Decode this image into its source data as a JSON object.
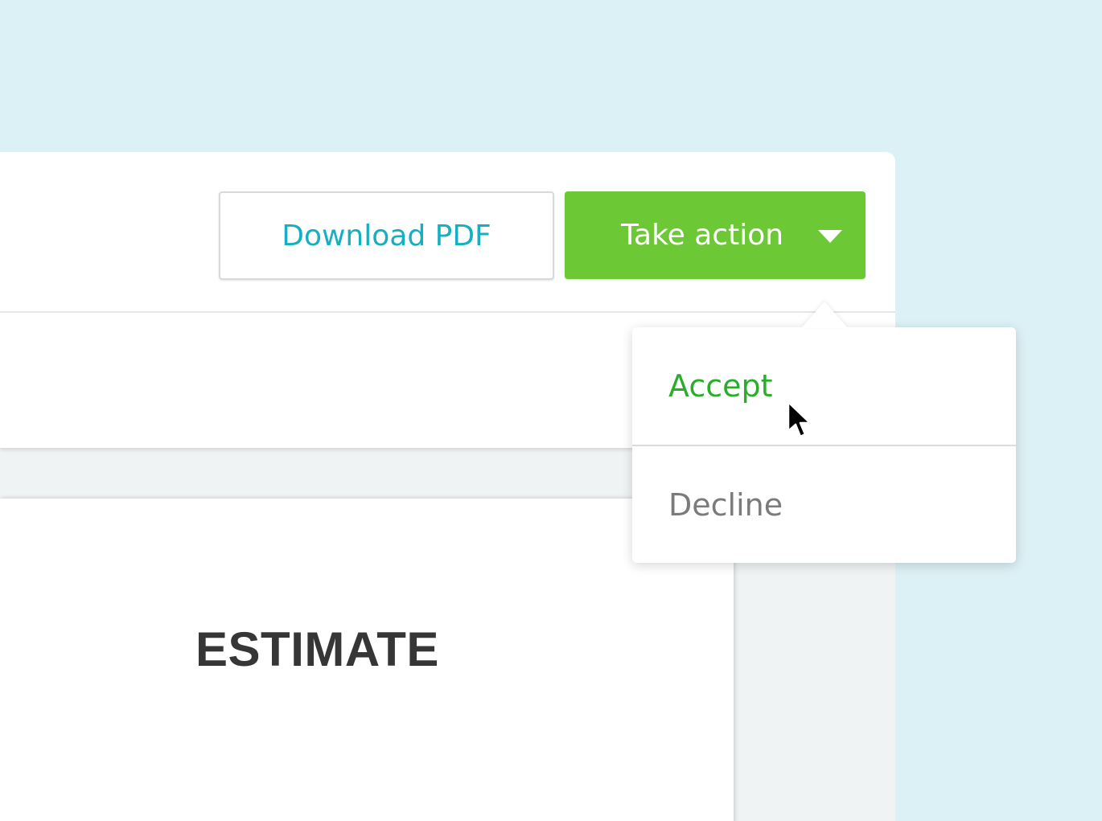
{
  "toolbar": {
    "download_label": "Download PDF",
    "action_label": "Take action",
    "action_icon": "chevron-down-icon"
  },
  "dropdown": {
    "items": [
      {
        "label": "Accept"
      },
      {
        "label": "Decline"
      }
    ]
  },
  "document": {
    "title": "ESTIMATE"
  },
  "colors": {
    "background": "#dbf1f5",
    "accent_green": "#6cc834",
    "accept_green": "#2aad2a",
    "download_teal": "#15b0c0",
    "decline_gray": "#7b7b7b",
    "title_dark": "#363636"
  }
}
